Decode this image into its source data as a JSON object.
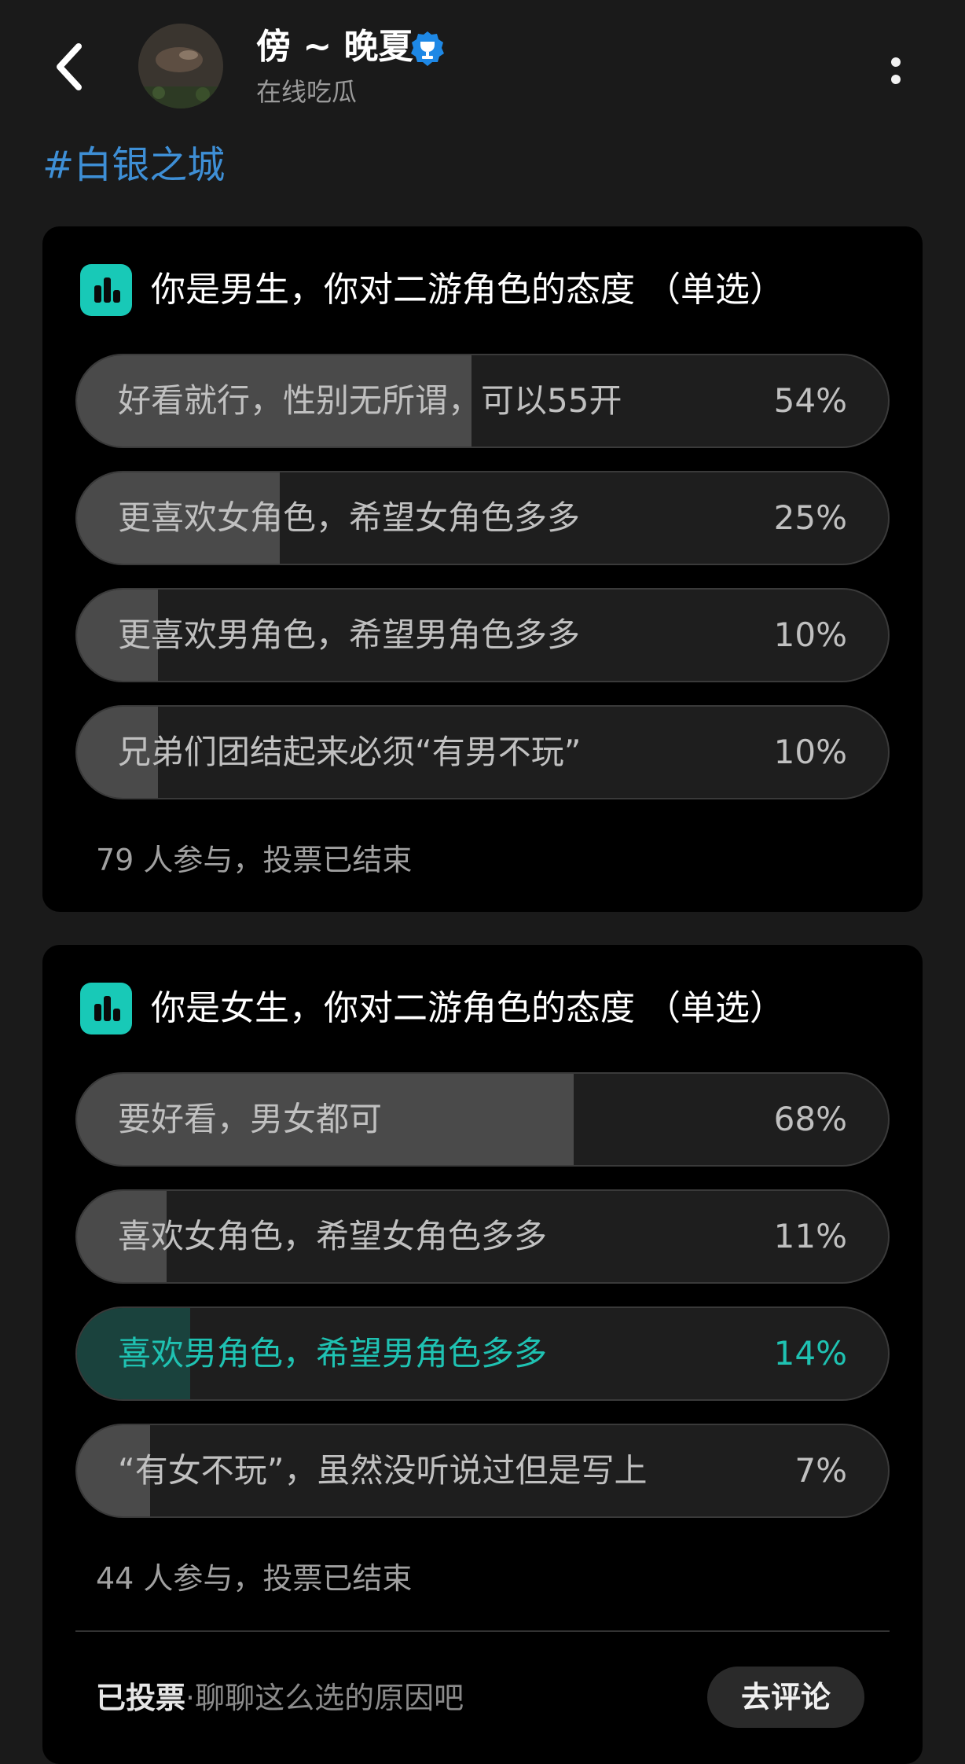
{
  "header": {
    "username": "傍 ~ 晚夏",
    "status": "在线吃瓜"
  },
  "hashtag": "#白银之城",
  "polls": [
    {
      "title": "你是男生，你对二游角色的态度 （单选）",
      "options": [
        {
          "label": "好看就行，性别无所谓，可以55开",
          "percent_text": "54%",
          "percent": 54,
          "selected": false
        },
        {
          "label": "更喜欢女角色，希望女角色多多",
          "percent_text": "25%",
          "percent": 25,
          "selected": false
        },
        {
          "label": "更喜欢男角色，希望男角色多多",
          "percent_text": "10%",
          "percent": 10,
          "selected": false
        },
        {
          "label": "兄弟们团结起来必须“有男不玩”",
          "percent_text": "10%",
          "percent": 10,
          "selected": false
        }
      ],
      "participants": "79 人参与，投票已结束"
    },
    {
      "title": "你是女生，你对二游角色的态度 （单选）",
      "options": [
        {
          "label": "要好看，男女都可",
          "percent_text": "68%",
          "percent": 68,
          "selected": false
        },
        {
          "label": "喜欢女角色，希望女角色多多",
          "percent_text": "11%",
          "percent": 11,
          "selected": false
        },
        {
          "label": "喜欢男角色，希望男角色多多",
          "percent_text": "14%",
          "percent": 14,
          "selected": true
        },
        {
          "label": "“有女不玩”，虽然没听说过但是写上",
          "percent_text": "7%",
          "percent": 7,
          "selected": false
        }
      ],
      "participants": "44 人参与，投票已结束",
      "footer": {
        "voted_label": "已投票",
        "separator": "·",
        "prompt": "聊聊这么选的原因吧",
        "comment_button": "去评论"
      }
    }
  ],
  "colors": {
    "accent": "#18c9b7",
    "hashtag": "#3e8fd6",
    "selected_text": "#1fc2b2",
    "verified_badge": "#1e88e5"
  },
  "icons": {
    "back": "chevron-left-icon",
    "verified": "verified-badge-icon",
    "more": "more-vertical-icon",
    "poll": "poll-chart-icon"
  }
}
